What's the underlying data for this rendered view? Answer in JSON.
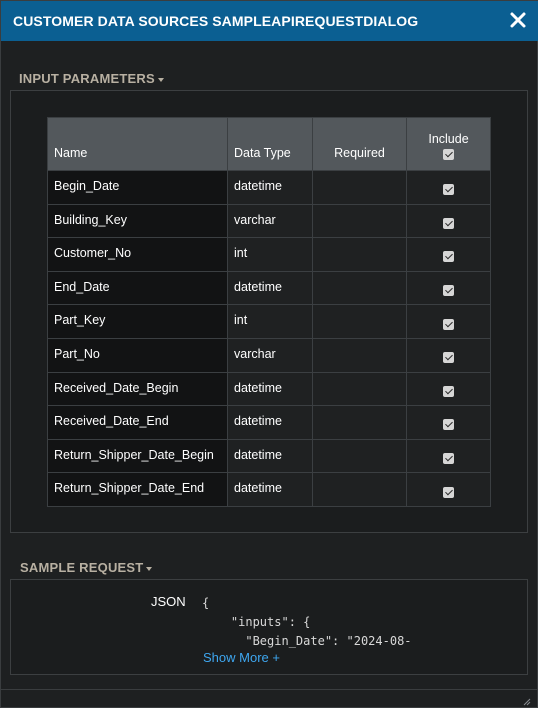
{
  "dialog": {
    "title": "CUSTOMER DATA SOURCES SAMPLEAPIREQUESTDIALOG",
    "close_icon": "close-icon"
  },
  "input_parameters": {
    "header": "INPUT PARAMETERS",
    "columns": {
      "name": "Name",
      "data_type": "Data Type",
      "required": "Required",
      "include": "Include"
    },
    "include_all_checked": true,
    "rows": [
      {
        "name": "Begin_Date",
        "data_type": "datetime",
        "required": "",
        "include": true
      },
      {
        "name": "Building_Key",
        "data_type": "varchar",
        "required": "",
        "include": true
      },
      {
        "name": "Customer_No",
        "data_type": "int",
        "required": "",
        "include": true
      },
      {
        "name": "End_Date",
        "data_type": "datetime",
        "required": "",
        "include": true
      },
      {
        "name": "Part_Key",
        "data_type": "int",
        "required": "",
        "include": true
      },
      {
        "name": "Part_No",
        "data_type": "varchar",
        "required": "",
        "include": true
      },
      {
        "name": "Received_Date_Begin",
        "data_type": "datetime",
        "required": "",
        "include": true
      },
      {
        "name": "Received_Date_End",
        "data_type": "datetime",
        "required": "",
        "include": true
      },
      {
        "name": "Return_Shipper_Date_Begin",
        "data_type": "datetime",
        "required": "",
        "include": true
      },
      {
        "name": "Return_Shipper_Date_End",
        "data_type": "datetime",
        "required": "",
        "include": true
      }
    ]
  },
  "sample_request": {
    "header": "SAMPLE REQUEST",
    "format_label": "JSON",
    "code_preview": "{\n    \"inputs\": {\n      \"Begin_Date\": \"2024-08-",
    "show_more_label": "Show More +"
  },
  "colors": {
    "title_bar": "#0b5f92",
    "link": "#3ea6ef",
    "section_header": "#b8b0a2"
  }
}
